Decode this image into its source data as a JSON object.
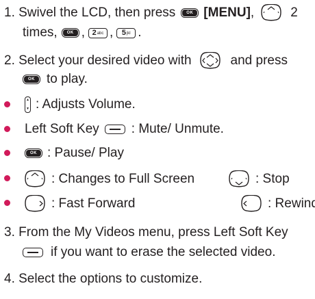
{
  "colors": {
    "text": "#231f20",
    "bullet": "#d11a5a"
  },
  "icons": {
    "ok_key": "ok-key-icon",
    "ok_label": "OK",
    "nav_all": "nav-key-all-directions-icon",
    "nav_up": "nav-key-up-icon",
    "nav_down": "nav-key-down-icon",
    "nav_left": "nav-key-left-icon",
    "nav_right": "nav-key-right-icon",
    "volume": "volume-side-key-icon",
    "left_soft": "left-soft-key-icon",
    "key2": {
      "digit": "2",
      "letters": "abc"
    },
    "key5": {
      "digit": "5",
      "letters": "jkl"
    }
  },
  "steps": {
    "s1": {
      "prefix": "1. Swivel the LCD, then press",
      "menu": "[MENU]",
      "comma": ",",
      "times": "2",
      "line2": "times,",
      "sep": ",",
      "end": "."
    },
    "s2": {
      "line1": "2. Select your desired video with",
      "press": "and press",
      "line2": "to play."
    },
    "s3": {
      "line1": "3. From the My Videos menu, press Left Soft Key",
      "line2": "if you want to erase the selected video."
    },
    "s4": {
      "line1": "4. Select the options to customize."
    }
  },
  "bullets": {
    "volume": ": Adjusts Volume.",
    "left_soft_prefix": "Left Soft Key",
    "left_soft": ": Mute/ Unmute.",
    "pause": ": Pause/ Play",
    "full_screen": ": Changes to Full Screen",
    "stop": ": Stop",
    "fast_forward": ": Fast Forward",
    "rewind": ": Rewind"
  }
}
